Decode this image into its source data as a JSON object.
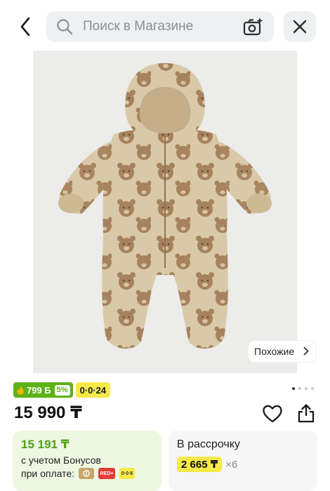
{
  "header": {
    "search_placeholder": "Поиск в Магазине"
  },
  "product": {
    "similar_label": "Похожие",
    "bonus_badge": "799 Б",
    "bonus_percent": "5%",
    "installment_badge": "0·0·24",
    "price": "15 990 ₸",
    "gallery": {
      "total": 4,
      "active_index": 0
    }
  },
  "bonus_card": {
    "amount": "15 191 ₸",
    "line1": "с учетом Бонусов",
    "line2": "при оплате:",
    "pay_icons": [
      {
        "name": "gold-card-icon",
        "label": ""
      },
      {
        "name": "red-card-icon",
        "label": "RED+"
      },
      {
        "name": "installment-card-icon",
        "label": "0·0·6"
      }
    ]
  },
  "installment_card": {
    "title": "В рассрочку",
    "amount": "2 665 ₸",
    "multiplier": "×6"
  },
  "colors": {
    "bonus_green": "#5bb318",
    "installment_yellow": "#f6e94a",
    "bonus_card_bg": "#eef7e2",
    "installment_card_bg": "#f6f6f6"
  }
}
